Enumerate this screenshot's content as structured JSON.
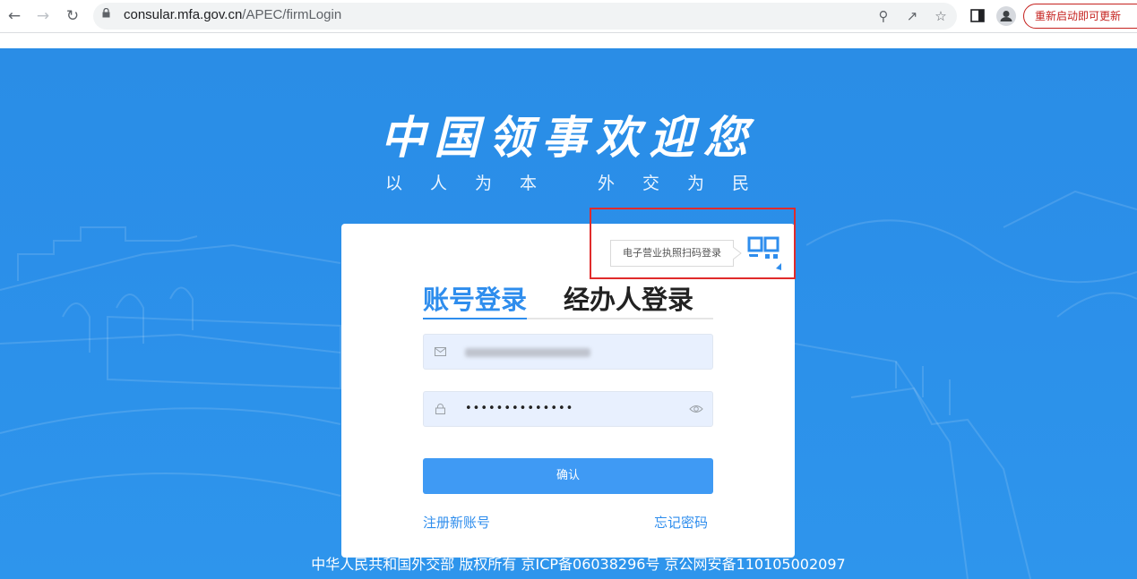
{
  "browser": {
    "url_host": "consular.mfa.gov.cn",
    "url_path": "/APEC/firmLogin",
    "update_label": "重新启动即可更新"
  },
  "header": {
    "title": "中国领事欢迎您",
    "slogan_chars": [
      "以",
      "人",
      "为",
      "本",
      "外",
      "交",
      "为",
      "民"
    ]
  },
  "login": {
    "qr_tip": "电子营业执照扫码登录",
    "tabs": [
      {
        "label": "账号登录",
        "active": true
      },
      {
        "label": "经办人登录",
        "active": false
      }
    ],
    "password_value": "••••••••••••••",
    "confirm_label": "确认",
    "register_label": "注册新账号",
    "forgot_label": "忘记密码"
  },
  "footer": {
    "text": "中华人民共和国外交部 版权所有 京ICP备06038296号 京公网安备110105002097"
  },
  "colors": {
    "page_bg": "#2b8fe9",
    "accent": "#2e8ded",
    "button": "#3f9af4",
    "highlight_box": "#e02b2b"
  }
}
